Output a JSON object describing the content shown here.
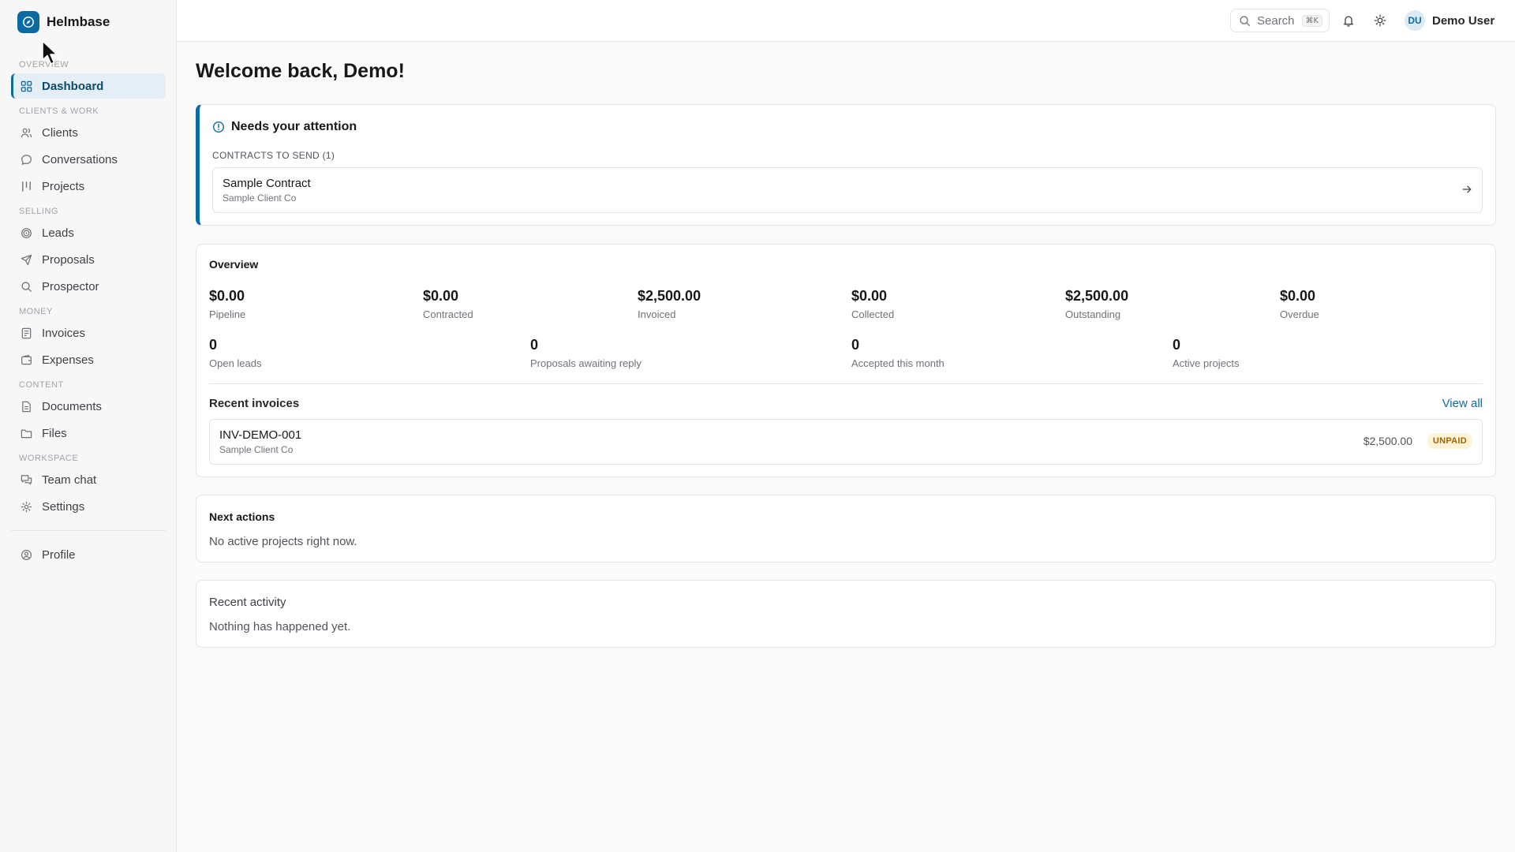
{
  "app": {
    "name": "Helmbase"
  },
  "sidebar": {
    "sections": {
      "overview": "Overview",
      "clients_work": "Clients & Work",
      "selling": "Selling",
      "money": "Money",
      "content": "Content",
      "workspace": "Workspace"
    },
    "items": {
      "dashboard": "Dashboard",
      "clients": "Clients",
      "conversations": "Conversations",
      "projects": "Projects",
      "leads": "Leads",
      "proposals": "Proposals",
      "prospector": "Prospector",
      "invoices": "Invoices",
      "expenses": "Expenses",
      "documents": "Documents",
      "files": "Files",
      "team_chat": "Team chat",
      "settings": "Settings",
      "profile": "Profile"
    },
    "active_item": "Dashboard"
  },
  "topbar": {
    "search_label": "Search",
    "search_shortcut": "⌘K",
    "user_initials": "DU",
    "user_name": "Demo User"
  },
  "page": {
    "title": "Welcome back, Demo!"
  },
  "attention": {
    "title": "Needs your attention",
    "subtitle": "CONTRACTS TO SEND (1)",
    "items": [
      {
        "title": "Sample Contract",
        "client": "Sample Client Co"
      }
    ]
  },
  "overview": {
    "title": "Overview",
    "money_stats": [
      {
        "value": "$0.00",
        "label": "Pipeline"
      },
      {
        "value": "$0.00",
        "label": "Contracted"
      },
      {
        "value": "$2,500.00",
        "label": "Invoiced"
      },
      {
        "value": "$0.00",
        "label": "Collected"
      },
      {
        "value": "$2,500.00",
        "label": "Outstanding"
      },
      {
        "value": "$0.00",
        "label": "Overdue"
      }
    ],
    "count_stats": [
      {
        "value": "0",
        "label": "Open leads"
      },
      {
        "value": "0",
        "label": "Proposals awaiting reply"
      },
      {
        "value": "0",
        "label": "Accepted this month"
      },
      {
        "value": "0",
        "label": "Active projects"
      }
    ],
    "recent_invoices_title": "Recent invoices",
    "view_all": "View all",
    "invoices": [
      {
        "number": "INV-DEMO-001",
        "client": "Sample Client Co",
        "amount": "$2,500.00",
        "status": "UNPAID"
      }
    ]
  },
  "next_actions": {
    "title": "Next actions",
    "body": "No active projects right now."
  },
  "recent_activity": {
    "title": "Recent activity",
    "body": "Nothing has happened yet."
  },
  "colors": {
    "accent": "#0c6ba3",
    "badge_bg": "#fdf3d6",
    "badge_fg": "#a16207"
  }
}
